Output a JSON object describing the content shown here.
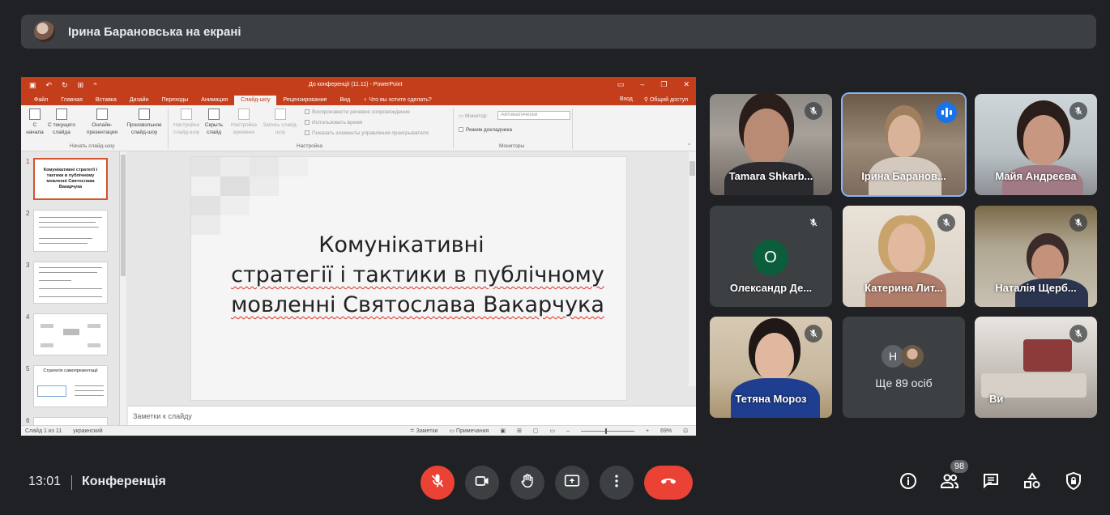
{
  "presenter": {
    "text": "Ірина Барановська на екрані"
  },
  "powerpoint": {
    "doc_title": "До конференції (11.11) - PowerPoint",
    "tabs": [
      "Файл",
      "Главная",
      "Вставка",
      "Дизайн",
      "Переходы",
      "Анимация",
      "Слайд-шоу",
      "Рецензирование",
      "Вид"
    ],
    "active_tab": "Слайд-шоу",
    "tell_me": "Что вы хотите сделать?",
    "sign_in": "Вход",
    "share": "Общий доступ",
    "ribbon": {
      "btn_from_start": "С начала",
      "btn_from_current": "С текущего слайда",
      "btn_online": "Онлайн-презентация",
      "btn_custom": "Произвольное слайд-шоу",
      "group_start": "Начать слайд-шоу",
      "btn_setup": "Настройка слайд-шоу",
      "btn_hide": "Скрыть слайд",
      "btn_timing": "Настройка времени",
      "btn_record": "Запись слайд-шоу",
      "chk_narration": "Воспроизвести речевое сопровождение",
      "chk_timings": "Использовать время",
      "chk_controls": "Показать элементы управления проигрывателя",
      "group_setup": "Настройка",
      "monitor_label": "Монитор:",
      "monitor_value": "Автоматически",
      "presenter_view": "Режим докладчика",
      "group_monitors": "Мониторы"
    },
    "thumbnails": [
      {
        "num": "1",
        "text": "Комунікативні стратегії і тактики в публічному мовленні Святослава Вакарчука"
      },
      {
        "num": "2",
        "text": ""
      },
      {
        "num": "3",
        "text": ""
      },
      {
        "num": "4",
        "text": ""
      },
      {
        "num": "5",
        "text": "Стратегія самопрезентації"
      },
      {
        "num": "6",
        "text": ""
      }
    ],
    "slide_title_line1": "Комунікативні",
    "slide_title_line2": "стратегії і тактики в публічному",
    "slide_title_line3": "мовленні Святослава Вакарчука",
    "notes_placeholder": "Заметки к слайду",
    "status_left": "Слайд 1 из 11",
    "status_lang": "украинский",
    "status_notes": "Заметки",
    "status_comments": "Примечания",
    "zoom": "69%"
  },
  "participants": [
    {
      "name": "Tamara Shkarb...",
      "muted": true
    },
    {
      "name": "Ірина Баранов...",
      "muted": false,
      "speaking": true
    },
    {
      "name": "Майя Андреєва",
      "muted": true
    },
    {
      "name": "Олександр Де...",
      "initial": "O",
      "muted": true
    },
    {
      "name": "Катерина Лит...",
      "muted": true
    },
    {
      "name": "Наталія Щерб...",
      "muted": true
    },
    {
      "name": "Тетяна Мороз",
      "muted": true
    },
    {
      "name": "Ще 89 осіб",
      "initial": "Н"
    },
    {
      "name": "Ви",
      "muted": true
    }
  ],
  "bottom": {
    "time": "13:01",
    "meeting": "Конференція",
    "people_count": "98"
  },
  "colors": {
    "accent_red": "#ea4335",
    "speaking": "#1a73e8",
    "ppt_brand": "#c43e1c"
  }
}
